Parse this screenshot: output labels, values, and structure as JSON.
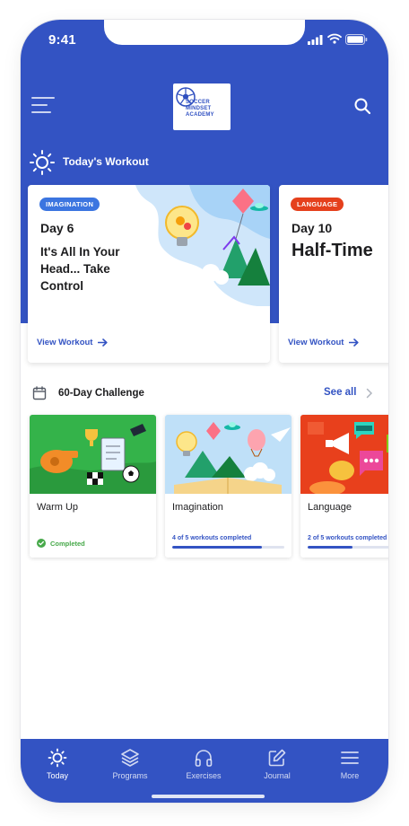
{
  "status_bar": {
    "time": "9:41"
  },
  "header": {
    "logo_lines": [
      "SOCCER",
      "MINDSET",
      "ACADEMY"
    ]
  },
  "today": {
    "section_title": "Today's Workout",
    "cards": [
      {
        "badge": "IMAGINATION",
        "badge_color": "#3b75e0",
        "day": "Day 6",
        "title": "It's All In Your Head... Take Control",
        "link": "View Workout"
      },
      {
        "badge": "LANGUAGE",
        "badge_color": "#e5401c",
        "day": "Day 10",
        "title": "Half-Time",
        "link": "View Workout"
      }
    ]
  },
  "challenge": {
    "title": "60-Day Challenge",
    "see_all": "See all",
    "cards": [
      {
        "name": "Warm Up",
        "status": "Completed"
      },
      {
        "name": "Imagination",
        "progress_text": "4 of 5 workouts completed",
        "progress": 0.8
      },
      {
        "name": "Language",
        "progress_text": "2 of 5 workouts completed",
        "progress": 0.4
      }
    ]
  },
  "tabs": [
    {
      "label": "Today",
      "icon": "sun-icon",
      "active": true
    },
    {
      "label": "Programs",
      "icon": "layers-icon",
      "active": false
    },
    {
      "label": "Exercises",
      "icon": "headphones-icon",
      "active": false
    },
    {
      "label": "Journal",
      "icon": "edit-icon",
      "active": false
    },
    {
      "label": "More",
      "icon": "hamburger-icon",
      "active": false
    }
  ],
  "colors": {
    "primary": "#3353c3",
    "completed": "#47a94a"
  }
}
